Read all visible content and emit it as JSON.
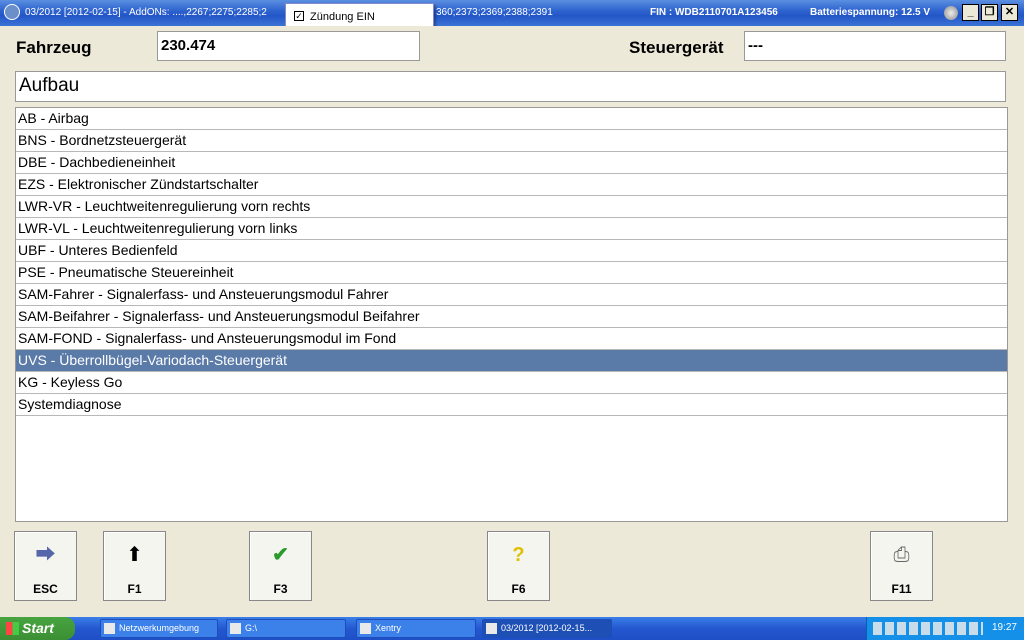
{
  "titlebar": {
    "title_left": "03/2012 [2012-02-15] - AddONs: ....,2267;2275;2285;2",
    "title_right": "360;2373;2369;2388;2391",
    "fin": "FIN : WDB2110701A123456",
    "battery": "Batteriespannung: 12.5 V"
  },
  "popup": {
    "checkbox_label": "Zündung EIN",
    "checked": true
  },
  "header": {
    "vehicle_label": "Fahrzeug",
    "vehicle_value": "230.474",
    "ecu_label": "Steuergerät",
    "ecu_value": "---"
  },
  "section_title": "Aufbau",
  "list_items": [
    "AB - Airbag",
    "BNS - Bordnetzsteuergerät",
    "DBE - Dachbedieneinheit",
    "EZS - Elektronischer Zündstartschalter",
    "LWR-VR - Leuchtweitenregulierung vorn rechts",
    "LWR-VL - Leuchtweitenregulierung vorn links",
    "UBF - Unteres Bedienfeld",
    "PSE - Pneumatische Steuereinheit",
    "SAM-Fahrer - Signalerfass- und Ansteuerungsmodul Fahrer",
    "SAM-Beifahrer - Signalerfass- und Ansteuerungsmodul Beifahrer",
    "SAM-FOND - Signalerfass- und Ansteuerungsmodul im Fond",
    "UVS - Überrollbügel-Variodach-Steuergerät",
    "KG - Keyless Go",
    "Systemdiagnose"
  ],
  "selected_index": 11,
  "fkeys": {
    "esc": "ESC",
    "f1": "F1",
    "f3": "F3",
    "f6": "F6",
    "f11": "F11"
  },
  "taskbar": {
    "start": "Start",
    "tasks": [
      "Netzwerkumgebung",
      "G:\\",
      "Xentry",
      "03/2012 [2012-02-15..."
    ],
    "clock": "19:27"
  },
  "colors": {
    "selection": "#5a7aa8",
    "titlebar": "#2356c7"
  }
}
